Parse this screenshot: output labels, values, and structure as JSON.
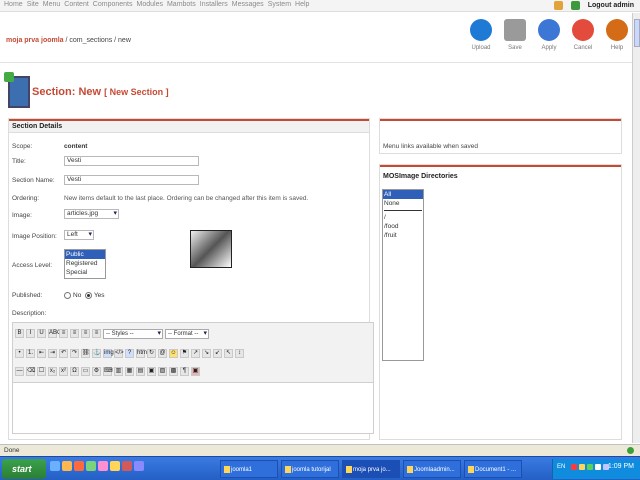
{
  "topmenu": [
    "Home",
    "Site",
    "Menu",
    "Content",
    "Components",
    "Modules",
    "Mambots",
    "Installers",
    "Messages",
    "System",
    "Help"
  ],
  "topbar": {
    "logout": "Logout admin"
  },
  "pathway": {
    "part1": "moja prva joomla",
    "part2": " / com_sections / new"
  },
  "toolbar": [
    {
      "label": "Upload",
      "color": "#1f7ad6"
    },
    {
      "label": "Save",
      "color": "#9a9a9a"
    },
    {
      "label": "Apply",
      "color": "#3d77d6"
    },
    {
      "label": "Cancel",
      "color": "#e34b3d"
    },
    {
      "label": "Help",
      "color": "#d46b16"
    }
  ],
  "page_title": {
    "prefix": "Section:",
    "main": "New",
    "sub": "[ New Section ]"
  },
  "section_details": {
    "heading": "Section Details",
    "scope_label": "Scope:",
    "scope_value": "content",
    "title_label": "Title:",
    "title_value": "Vesti",
    "name_label": "Section Name:",
    "name_value": "Vesti",
    "ordering_label": "Ordering:",
    "ordering_value": "New items default to the last place. Ordering can be changed after this item is saved.",
    "image_label": "Image:",
    "image_value": "articles.jpg",
    "image_pos_label": "Image Position:",
    "image_pos_value": "Left",
    "access_label": "Access Level:",
    "access_options": [
      "Public",
      "Registered",
      "Special"
    ],
    "published_label": "Published:",
    "published_no": "No",
    "published_yes": "Yes",
    "description_label": "Description:"
  },
  "editor": {
    "styles": "-- Styles --",
    "format": "-- Format --",
    "tools_row1": [
      "B",
      "I",
      "U",
      "ABC",
      "≡",
      "≡",
      "≡",
      "≡"
    ],
    "tools_row2": [
      "•",
      "1.",
      "⇤",
      "⇥",
      "↶",
      "↷",
      "⛓",
      "⚓",
      "img",
      "</>",
      "?",
      "htm",
      "↻",
      "@",
      "☺",
      "⚑",
      "↗",
      "↘",
      "↙",
      "↖",
      "↕"
    ],
    "tools_row3": [
      "—",
      "⌫",
      "☐",
      "x₂",
      "x²",
      "Ω",
      "▭",
      "⚙",
      "⌨",
      "▥",
      "▦",
      "▤",
      "▣",
      "▨",
      "▩",
      "¶",
      "▣"
    ]
  },
  "menu_links": {
    "text": "Menu links available when saved"
  },
  "mosimage": {
    "heading": "MOSImage Directories",
    "items": [
      "All",
      "None",
      "/",
      "/food",
      "/fruit"
    ]
  },
  "status": {
    "text": "Done"
  },
  "taskbar": {
    "start": "start",
    "tasks": [
      {
        "label": "joomla1",
        "active": false
      },
      {
        "label": "joomla tutorijal",
        "active": false
      },
      {
        "label": "moja prva jo...",
        "active": true
      },
      {
        "label": "Joomlaadmin...",
        "active": false
      },
      {
        "label": "Document1 - ...",
        "active": false
      }
    ],
    "lang": "EN",
    "clock": "1:09 PM"
  }
}
